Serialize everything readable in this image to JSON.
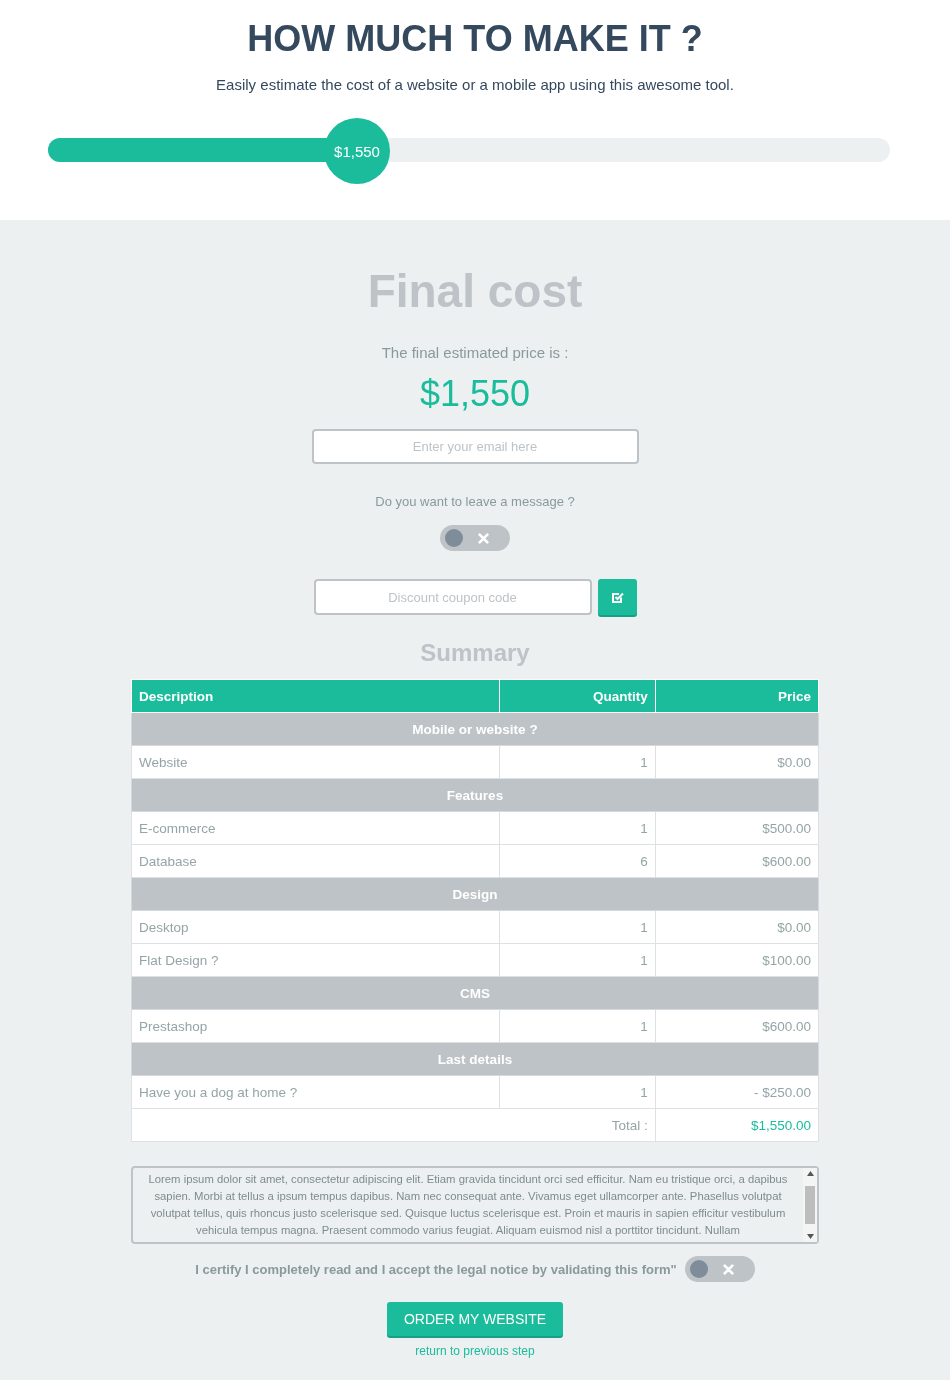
{
  "header": {
    "title": "HOW MUCH TO MAKE IT ?",
    "subtitle": "Easily estimate the cost of a website or a mobile app using this awesome tool.",
    "slider": {
      "level": 0.367,
      "reading": "$1,550"
    }
  },
  "final": {
    "title": "Final cost",
    "price_label": "The final estimated price is :",
    "price": "$1,550",
    "email": {
      "placeholder": "Enter your email here"
    },
    "message_question": "Do you want to leave a message ?",
    "message_toggle": {
      "on": false
    },
    "coupon": {
      "placeholder": "Discount coupon code"
    }
  },
  "summary": {
    "title": "Summary",
    "columns": [
      "Description",
      "Quantity",
      "Price"
    ],
    "rows": [
      {
        "kind": "group",
        "label": "Mobile or website ?"
      },
      {
        "kind": "item",
        "description": "Website",
        "quantity": "1",
        "price": "$0.00"
      },
      {
        "kind": "group",
        "label": "Features"
      },
      {
        "kind": "item",
        "description": "E-commerce",
        "quantity": "1",
        "price": "$500.00"
      },
      {
        "kind": "item",
        "description": "Database",
        "quantity": "6",
        "price": "$600.00"
      },
      {
        "kind": "group",
        "label": "Design"
      },
      {
        "kind": "item",
        "description": "Desktop",
        "quantity": "1",
        "price": "$0.00"
      },
      {
        "kind": "item",
        "description": "Flat Design ?",
        "quantity": "1",
        "price": "$100.00"
      },
      {
        "kind": "group",
        "label": "CMS"
      },
      {
        "kind": "item",
        "description": "Prestashop",
        "quantity": "1",
        "price": "$600.00"
      },
      {
        "kind": "group",
        "label": "Last details"
      },
      {
        "kind": "item",
        "description": "Have you a dog at home ?",
        "quantity": "1",
        "price": "- $250.00"
      },
      {
        "kind": "total",
        "total_label": "Total :",
        "price": "$1,550.00"
      }
    ]
  },
  "legal": {
    "text": "Lorem ipsum dolor sit amet, consectetur adipiscing elit. Etiam gravida tincidunt orci sed efficitur. Nam eu tristique orci, a dapibus sapien. Morbi at tellus a ipsum tempus dapibus. Nam nec consequat ante. Vivamus eget ullamcorper ante. Phasellus volutpat volutpat tellus, quis rhoncus justo scelerisque sed. Quisque luctus scelerisque est. Proin et mauris in sapien efficitur vestibulum vehicula tempus magna. Praesent commodo varius feugiat. Aliquam euismod nisl a porttitor tincidunt. Nullam",
    "certify": "I certify I completely read and I accept the legal notice by validating this form\"",
    "certify_toggle": {
      "on": false
    },
    "order_button": "ORDER MY WEBSITE",
    "back_link": "return to previous step"
  }
}
